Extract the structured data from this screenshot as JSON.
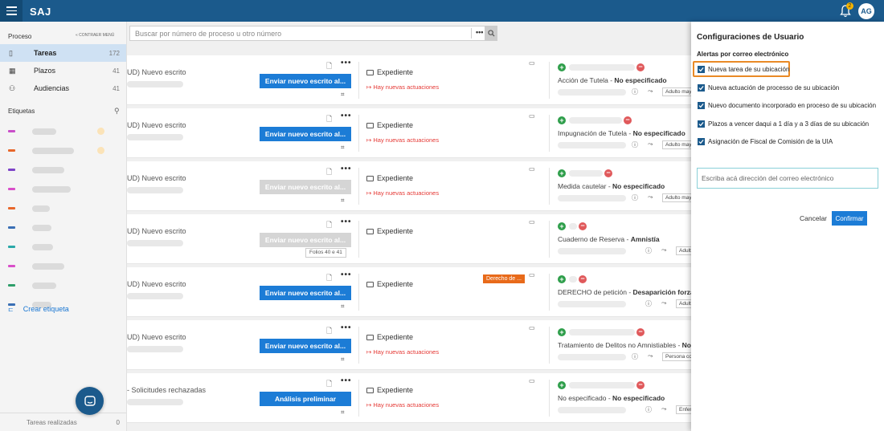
{
  "app": {
    "title": "SAJ",
    "notifications": "2",
    "user_initials": "AG"
  },
  "sidebar": {
    "section_label": "Proceso",
    "collapse_label": "« CONTRAER MENÚ",
    "items": [
      {
        "label": "Tareas",
        "count": "172",
        "icon": "tasks-icon"
      },
      {
        "label": "Plazos",
        "count": "41",
        "icon": "calendar-icon"
      },
      {
        "label": "Audiencias",
        "count": "41",
        "icon": "people-icon"
      }
    ],
    "labels_title": "Etiquetas",
    "tag_colors": [
      "#c94fc9",
      "#e8672b",
      "#7e44c8",
      "#d94fc9",
      "#e8672b",
      "#3a6fb5",
      "#2aa8a8",
      "#d94fc9",
      "#2e9e6a",
      "#3a6fb5"
    ],
    "create_label": "Crear etiqueta",
    "footer_label": "Tareas realizadas",
    "footer_count": "0"
  },
  "search": {
    "placeholder": "Buscar por número de proceso u otro número",
    "more": "•••"
  },
  "cards": [
    {
      "title": "UD) Nuevo escrito",
      "button": "Enviar nuevo escrito al...",
      "button_enabled": true,
      "expediente": "Expediente",
      "nuevas": "Hay nuevas actuaciones",
      "proceso_a": "Acción de Tutela",
      "proceso_b": "No especificado",
      "chip": "Adulto may",
      "tag": "",
      "folios": "",
      "sep": " - "
    },
    {
      "title": "UD) Nuevo escrito",
      "button": "Enviar nuevo escrito al...",
      "button_enabled": true,
      "expediente": "Expediente",
      "nuevas": "Hay nuevas actuaciones",
      "proceso_a": "Impugnación de Tutela",
      "proceso_b": "No especificado",
      "chip": "Adulto may",
      "tag": "",
      "folios": "",
      "sep": " - "
    },
    {
      "title": "UD) Nuevo escrito",
      "button": "Enviar nuevo escrito al...",
      "button_enabled": false,
      "expediente": "Expediente",
      "nuevas": "Hay nuevas actuaciones",
      "proceso_a": "Medida cautelar",
      "proceso_b": "No especificado",
      "chip": "Adulto may",
      "tag": "",
      "folios": "",
      "sep": " - "
    },
    {
      "title": "UD) Nuevo escrito",
      "button": "Enviar nuevo escrito al...",
      "button_enabled": false,
      "expediente": "Expediente",
      "nuevas": "",
      "proceso_a": "Cuaderno de Reserva",
      "proceso_b": "Amnistía",
      "chip": "Adult",
      "tag": "",
      "folios": "Folios 40 e 41",
      "sep": " - "
    },
    {
      "title": "UD) Nuevo escrito",
      "button": "Enviar nuevo escrito al...",
      "button_enabled": true,
      "expediente": "Expediente",
      "nuevas": "",
      "proceso_a": "DERECHO de petición",
      "proceso_b": "Desaparición forzada",
      "chip": "Adult",
      "tag": "Derecho de ...",
      "folios": "",
      "sep": " - "
    },
    {
      "title": "UD) Nuevo escrito",
      "button": "Enviar nuevo escrito al...",
      "button_enabled": true,
      "expediente": "Expediente",
      "nuevas": "Hay nuevas actuaciones",
      "proceso_a": "Tratamiento de Delitos no Amnistiables",
      "proceso_b": "No e",
      "chip": "Persona co",
      "tag": "",
      "folios": "",
      "sep": " - "
    },
    {
      "title": "- Solicitudes rechazadas",
      "button": "Análisis preliminar",
      "button_enabled": true,
      "expediente": "Expediente",
      "nuevas": "Hay nuevas actuaciones",
      "proceso_a": "No especificado",
      "proceso_b": "No especificado",
      "chip": "Enfermedad",
      "tag": "",
      "folios": "",
      "sep": " - "
    }
  ],
  "panel": {
    "title": "Configuraciones de Usuario",
    "subtitle": "Alertas por correo electrónico",
    "options": [
      "Nueva tarea de su ubicación",
      "Nueva actuación de processo de su ubicación",
      "Nuevo documento incorporado en proceso de su ubicación",
      "Plazos a vencer daqui a 1 día y a 3 días de su ubicación",
      "Asignación de Fiscal de Comisión de la UIA"
    ],
    "email_placeholder": "Escriba acá dirección del correo electrónico",
    "cancel": "Cancelar",
    "confirm": "Confirmar",
    "highlight_color": "#e98a26"
  }
}
